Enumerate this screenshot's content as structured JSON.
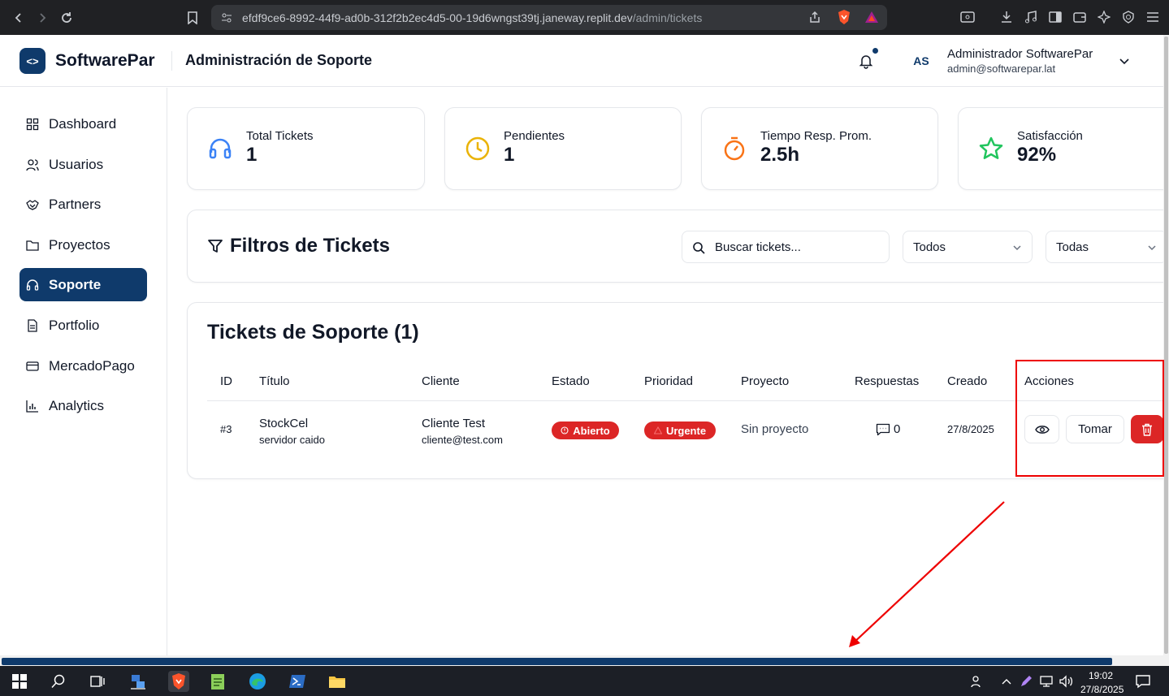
{
  "browser": {
    "url_host": "efdf9ce6-8992-44f9-ad0b-312f2b2ec4d5-00-19d6wngst39tj.janeway.replit.dev",
    "url_path": "/admin/tickets"
  },
  "header": {
    "logo_text": "<>",
    "brand": "SoftwarePar",
    "page_title": "Administración de Soporte",
    "avatar_initials": "AS",
    "user_name": "Administrador SoftwarePar",
    "user_email": "admin@softwarepar.lat"
  },
  "sidebar": {
    "items": [
      {
        "label": "Dashboard",
        "icon": "grid-icon"
      },
      {
        "label": "Usuarios",
        "icon": "users-icon"
      },
      {
        "label": "Partners",
        "icon": "handshake-icon"
      },
      {
        "label": "Proyectos",
        "icon": "folder-icon"
      },
      {
        "label": "Soporte",
        "icon": "headphones-icon",
        "active": true
      },
      {
        "label": "Portfolio",
        "icon": "file-icon"
      },
      {
        "label": "MercadoPago",
        "icon": "card-icon"
      },
      {
        "label": "Analytics",
        "icon": "bar-chart-icon"
      }
    ]
  },
  "stats": [
    {
      "label": "Total Tickets",
      "value": "1",
      "icon": "headphones-icon",
      "color": "#3b82f6"
    },
    {
      "label": "Pendientes",
      "value": "1",
      "icon": "clock-icon",
      "color": "#eab308"
    },
    {
      "label": "Tiempo Resp. Prom.",
      "value": "2.5h",
      "icon": "timer-icon",
      "color": "#f97316"
    },
    {
      "label": "Satisfacción",
      "value": "92%",
      "icon": "star-icon",
      "color": "#22c55e"
    }
  ],
  "filters": {
    "title": "Filtros de Tickets",
    "search_placeholder": "Buscar tickets...",
    "status_select": "Todos",
    "priority_select": "Todas"
  },
  "tickets": {
    "title": "Tickets de Soporte (1)",
    "columns": [
      "ID",
      "Título",
      "Cliente",
      "Estado",
      "Prioridad",
      "Proyecto",
      "Respuestas",
      "Creado",
      "Acciones"
    ],
    "rows": [
      {
        "id": "#3",
        "title": "StockCel",
        "subtitle": "servidor caido",
        "client_name": "Cliente Test",
        "client_email": "cliente@test.com",
        "status": "Abierto",
        "priority": "Urgente",
        "project": "Sin proyecto",
        "responses": "0",
        "created": "27/8/2025",
        "take_label": "Tomar"
      }
    ]
  },
  "taskbar": {
    "time": "19:02",
    "date": "27/8/2025"
  }
}
